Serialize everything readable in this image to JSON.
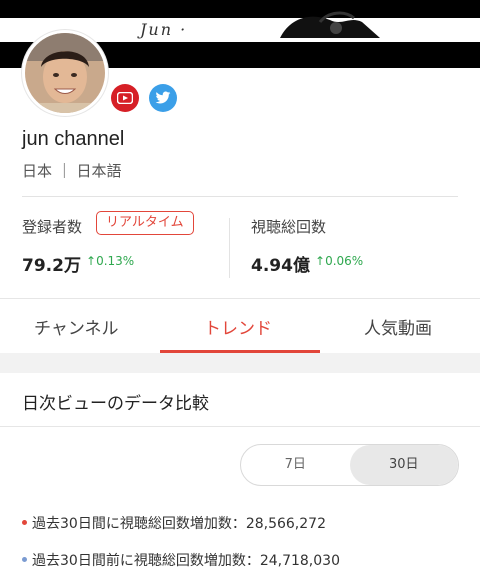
{
  "banner": {
    "scribble": "Jun ·"
  },
  "channel": {
    "name": "jun channel",
    "meta": "日本 ｜ 日本語"
  },
  "social": {
    "youtube_icon": "youtube-icon",
    "twitter_icon": "twitter-icon"
  },
  "stats": {
    "subscribers": {
      "label": "登録者数",
      "badge": "リアルタイム",
      "value": "79.2万",
      "change": "0.13%"
    },
    "views": {
      "label": "視聴総回数",
      "value": "4.94億",
      "change": "0.06%"
    }
  },
  "tabs": [
    {
      "label": "チャンネル",
      "active": false
    },
    {
      "label": "トレンド",
      "active": true
    },
    {
      "label": "人気動画",
      "active": false
    }
  ],
  "section": {
    "title": "日次ビューのデータ比較"
  },
  "range_toggle": {
    "options": [
      "7日",
      "30日"
    ],
    "selected": "30日"
  },
  "comparison": [
    {
      "text": "過去30日間に視聴総回数増加数：28,566,272",
      "dot_color": "#e2463a"
    },
    {
      "text": "過去30日間前に視聴総回数増加数：24,718,030",
      "dot_color": "#7b9bd1"
    }
  ],
  "colors": {
    "accent": "#e2463a",
    "positive": "#2fa84f"
  }
}
